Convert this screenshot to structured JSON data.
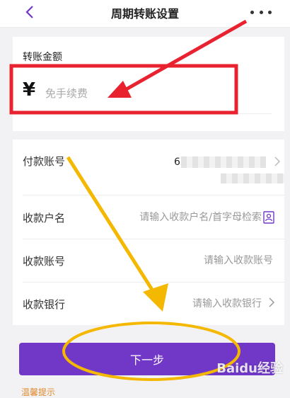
{
  "header": {
    "title": "周期转账设置",
    "back_icon": "chevron-left-icon",
    "more_icon": "more-dots-icon"
  },
  "amount": {
    "label": "转账金额",
    "currency": "¥",
    "placeholder": "免手续费"
  },
  "form": {
    "payer_account": {
      "label": "付款账号",
      "visible_prefix": "62"
    },
    "payee_name": {
      "label": "收款户名",
      "placeholder": "请输入收款户名/首字母检索"
    },
    "payee_account": {
      "label": "收款账号",
      "placeholder": "请输入收款账号"
    },
    "payee_bank": {
      "label": "收款银行",
      "placeholder": "请输入收款银行"
    }
  },
  "next_button": {
    "label": "下一步"
  },
  "hint": {
    "text": "温馨提示"
  },
  "watermark": {
    "text": "Baidu经验"
  },
  "colors": {
    "accent": "#7138c8",
    "annotation_red": "#e8222e",
    "annotation_yellow": "#f5b800",
    "background": "#f2f2f5"
  }
}
